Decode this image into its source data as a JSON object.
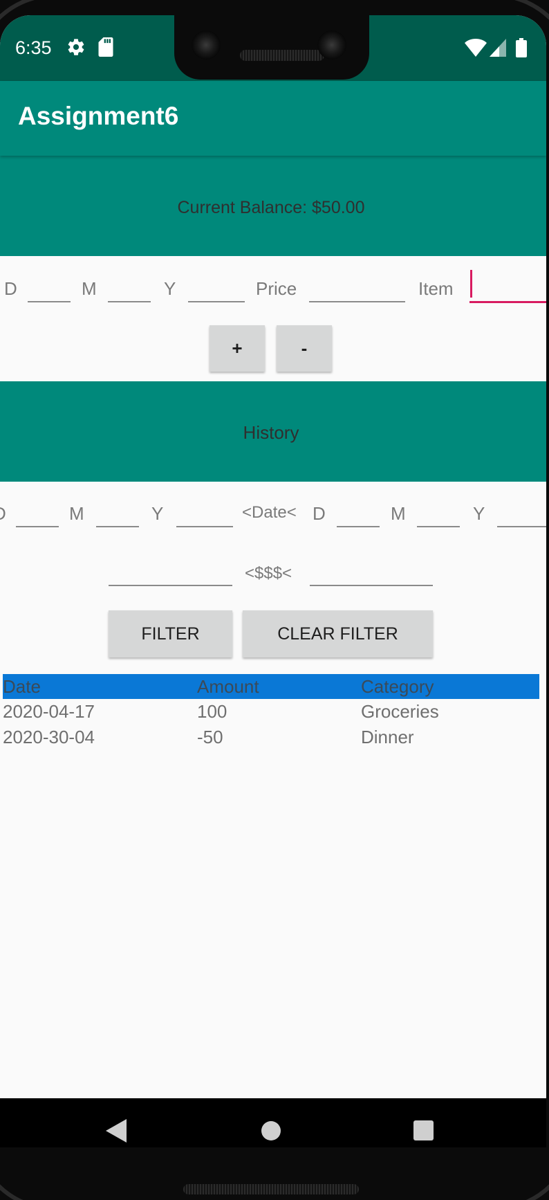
{
  "status_bar": {
    "time": "6:35",
    "icons": [
      "gear-icon",
      "sd-card-icon",
      "wifi-icon",
      "signal-icon",
      "battery-icon"
    ]
  },
  "app_bar": {
    "title": "Assignment6"
  },
  "balance": {
    "text": "Current Balance: $50.00"
  },
  "entry_form": {
    "day_label": "D",
    "month_label": "M",
    "year_label": "Y",
    "price_label": "Price",
    "item_label": "Item",
    "day_value": "",
    "month_value": "",
    "year_value": "",
    "price_value": "",
    "item_value": "",
    "add_button": "+",
    "subtract_button": "-"
  },
  "history": {
    "title": "History"
  },
  "filter": {
    "from_day_label": "D",
    "from_month_label": "M",
    "from_year_label": "Y",
    "date_separator": "<Date<",
    "to_day_label": "D",
    "to_month_label": "M",
    "to_year_label": "Y",
    "amount_separator": "<$$$<",
    "filter_button": "FILTER",
    "clear_button": "CLEAR FILTER"
  },
  "table": {
    "headers": [
      "Date",
      "Amount",
      "Category"
    ],
    "rows": [
      [
        "2020-04-17",
        "100",
        "Groceries"
      ],
      [
        "2020-30-04",
        "-50",
        "Dinner"
      ]
    ]
  },
  "colors": {
    "status_bar": "#005c4d",
    "primary": "#00897b",
    "accent": "#d81b60",
    "table_header": "#0a78d6",
    "background": "#fafafa"
  }
}
